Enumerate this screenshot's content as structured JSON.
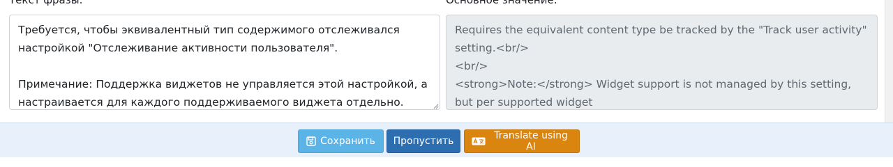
{
  "form": {
    "phrase_text_label": "Текст фразы:",
    "master_value_label": "Основное значение:",
    "phrase_text_value": "Требуется, чтобы эквивалентный тип содержимого отслеживался настройкой \"Отслеживание активности пользователя\".\n\nПримечание: Поддержка виджетов не управляется этой настройкой, а настраивается для каждого поддерживаемого виджета отдельно.",
    "master_value": "Requires the equivalent content type be tracked by the \"Track user activity\" setting.<br/>\n<br/>\n<strong>Note:</strong> Widget support is not managed by this setting, but per supported widget"
  },
  "footer": {
    "save_label": "Сохранить",
    "skip_label": "Пропустить",
    "translate_label": "Translate using AI",
    "save_icon": "floppy-disk-icon",
    "translate_icon": "ai-translate-icon"
  },
  "colors": {
    "save_button": "#5bb3e6",
    "skip_button": "#2d6eb1",
    "translate_button": "#d9850f",
    "footer_background": "#e8f1fb",
    "readonly_background": "#e9ecef"
  }
}
